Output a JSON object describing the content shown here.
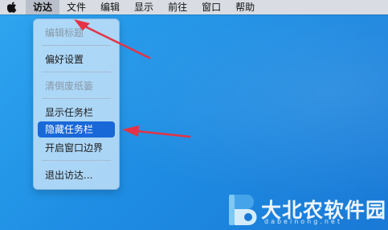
{
  "menubar": {
    "apple_icon": "apple-logo-icon",
    "items": [
      {
        "label": "访达"
      },
      {
        "label": "文件"
      },
      {
        "label": "编辑"
      },
      {
        "label": "显示"
      },
      {
        "label": "前往"
      },
      {
        "label": "窗口"
      },
      {
        "label": "帮助"
      }
    ]
  },
  "dropdown": {
    "items": [
      {
        "label": "编辑标题",
        "enabled": false
      },
      {
        "label": "偏好设置",
        "enabled": true
      },
      {
        "label": "清倒废纸篓",
        "enabled": false
      },
      {
        "label": "显示任务栏",
        "enabled": true
      },
      {
        "label": "隐藏任务栏",
        "enabled": true,
        "highlighted": true
      },
      {
        "label": "开启窗口边界",
        "enabled": true
      },
      {
        "label": "退出访达...",
        "enabled": true
      }
    ]
  },
  "annotation_color": "#e53345",
  "highlight_color": "#1868d8",
  "watermark": {
    "text": "大北农软件园",
    "url": "dabeinong.net"
  }
}
